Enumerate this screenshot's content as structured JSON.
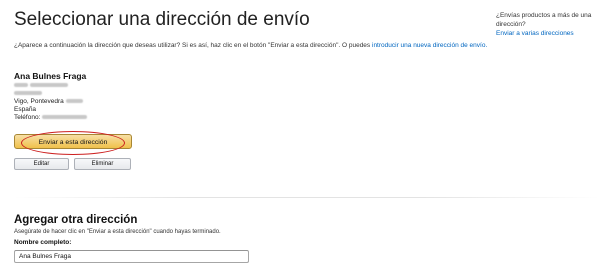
{
  "header": {
    "title": "Seleccionar una dirección de envío",
    "side_question": "¿Envías productos a más de una dirección?",
    "side_link": "Enviar a varias direcciones"
  },
  "intro": {
    "text": "¿Aparece a continuación la dirección que deseas utilizar? Si es así, haz clic en el botón \"Enviar a esta dirección\". O puedes",
    "link": "introducir una nueva dirección de envío."
  },
  "address": {
    "name": "Ana Bulnes Fraga",
    "city_line": "Vigo, Pontevedra",
    "country": "España",
    "phone_label": "Teléfono:"
  },
  "buttons": {
    "ship_here": "Enviar a esta dirección",
    "edit": "Editar",
    "delete": "Eliminar"
  },
  "add_section": {
    "title": "Agregar otra dirección",
    "hint": "Asegúrate de hacer clic en \"Enviar a esta dirección\" cuando hayas terminado.",
    "full_name_label": "Nombre completo:",
    "full_name_value": "Ana Bulnes Fraga"
  },
  "colors": {
    "link": "#0066c0",
    "primary_button": "#f0c14b",
    "annotation_ring": "#cc1f1f"
  }
}
